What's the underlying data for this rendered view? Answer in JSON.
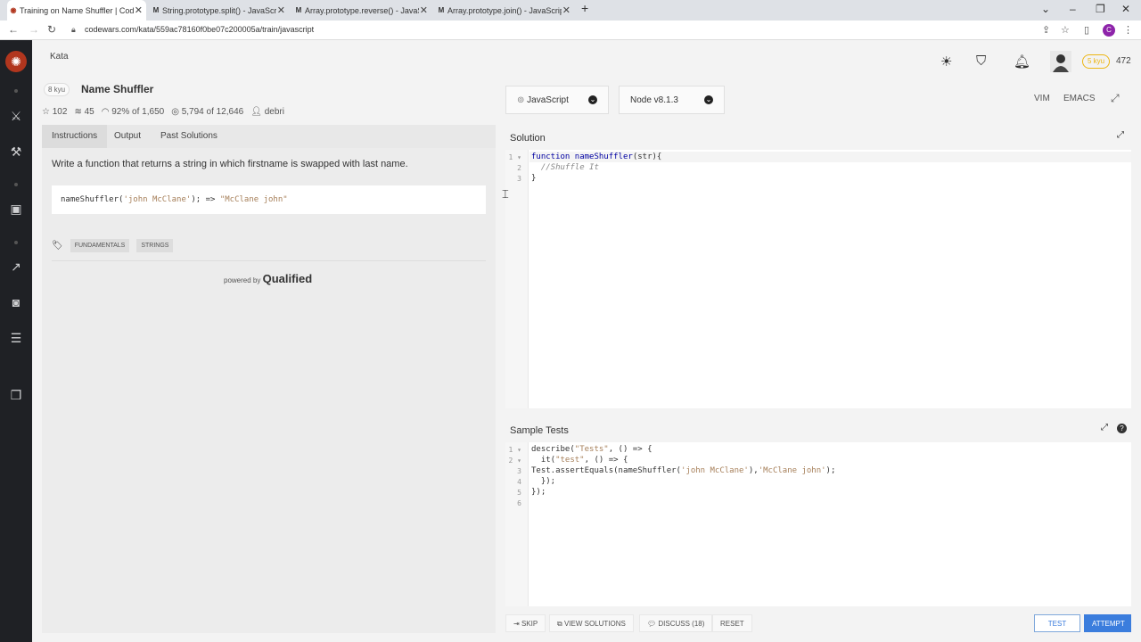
{
  "browser": {
    "tabs": [
      {
        "title": "Training on Name Shuffler | Codewars",
        "icon": "codewars-icon"
      },
      {
        "title": "String.prototype.split() - JavaScript",
        "icon": "mdn-icon"
      },
      {
        "title": "Array.prototype.reverse() - JavaScript",
        "icon": "mdn-icon"
      },
      {
        "title": "Array.prototype.join() - JavaScript",
        "icon": "mdn-icon"
      }
    ],
    "url": "codewars.com/kata/559ac78160f0be07c200005a/train/javascript",
    "profile_initial": "C"
  },
  "header": {
    "crumb": "Kata",
    "rank_badge": "5 kyu",
    "honor": "472"
  },
  "kata": {
    "kyu": "8 kyu",
    "title": "Name Shuffler",
    "stars": "102",
    "collections": "45",
    "satisfaction": "92% of 1,650",
    "completions": "5,794 of 12,646",
    "author": "debri",
    "tabs": [
      "Instructions",
      "Output",
      "Past Solutions"
    ],
    "description": "Write a function that returns a string in which firstname is swapped with last name.",
    "example_fn": "nameShuffler(",
    "example_arg": "'john McClane'",
    "example_mid": "); => ",
    "example_res": "\"McClane john\"",
    "tags": [
      "FUNDAMENTALS",
      "STRINGS"
    ],
    "powered_by": "powered by",
    "qualified": "Qualified"
  },
  "editor": {
    "language": "JavaScript",
    "runtime": "Node v8.1.3",
    "modes": [
      "VIM",
      "EMACS"
    ],
    "solution_title": "Solution",
    "tests_title": "Sample Tests"
  },
  "actions": {
    "skip": "SKIP",
    "view_solutions": "VIEW SOLUTIONS",
    "discuss": "DISCUSS (18)",
    "reset": "RESET",
    "test": "TEST",
    "attempt": "ATTEMPT"
  }
}
